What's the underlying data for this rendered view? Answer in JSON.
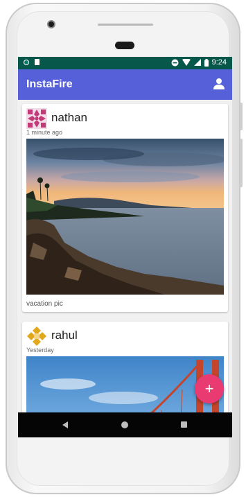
{
  "status_bar": {
    "time": "9:24"
  },
  "app_bar": {
    "title": "InstaFire",
    "account_icon": "account-icon"
  },
  "posts": [
    {
      "username": "nathan",
      "time": "1 minute ago",
      "caption": "vacation pic",
      "avatar_color": "#c23a78"
    },
    {
      "username": "rahul",
      "time": "Yesterday",
      "caption": "",
      "avatar_color": "#e2a81c"
    }
  ],
  "fab": {
    "label": "+",
    "color": "#e93a72"
  },
  "colors": {
    "status_bar": "#07574a",
    "app_bar": "#5560d9"
  }
}
